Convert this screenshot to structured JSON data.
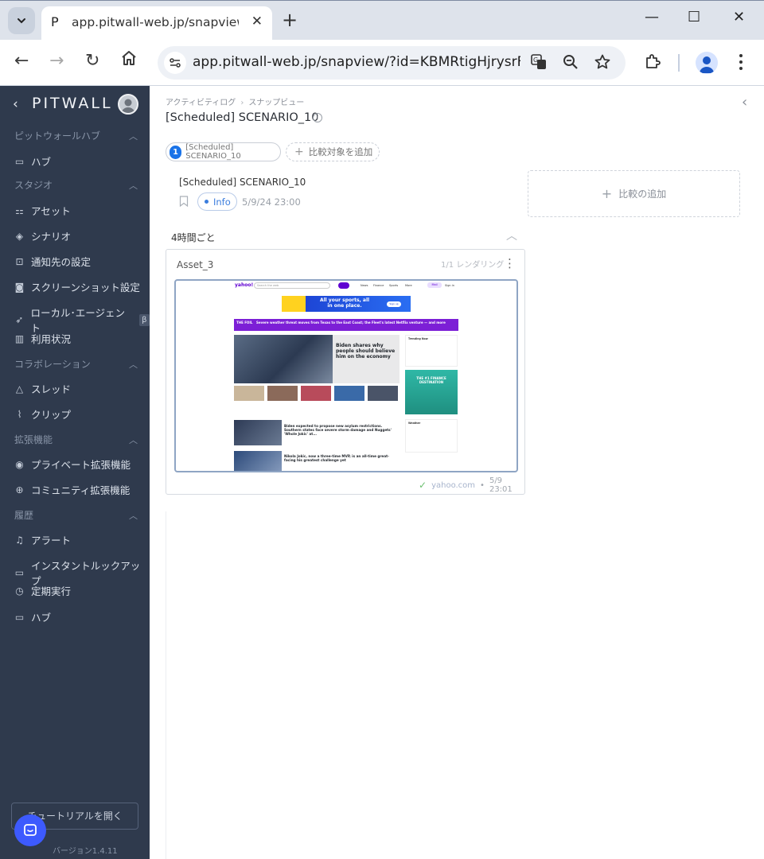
{
  "browser": {
    "tab_title": "app.pitwall-web.jp/snapview/?id",
    "favicon_glyph": "P",
    "url": "app.pitwall-web.jp/snapview/?id=KBMRtigHjrysrFKf..."
  },
  "sidebar": {
    "logo": "PITWALL",
    "sections": [
      {
        "title": "ピットウォールハブ",
        "items": [
          {
            "label": "ハブ",
            "icon": "box-icon"
          }
        ]
      },
      {
        "title": "スタジオ",
        "items": [
          {
            "label": "アセット",
            "icon": "grid-icon"
          },
          {
            "label": "シナリオ",
            "icon": "layers-icon"
          },
          {
            "label": "通知先の設定",
            "icon": "inbox-icon"
          },
          {
            "label": "スクリーンショット設定",
            "icon": "camera-icon"
          },
          {
            "label": "ローカル･エージェント",
            "icon": "rocket-icon",
            "badge": "β"
          },
          {
            "label": "利用状況",
            "icon": "bar-chart-icon"
          }
        ]
      },
      {
        "title": "コラボレーション",
        "items": [
          {
            "label": "スレッド",
            "icon": "triangle-icon"
          },
          {
            "label": "クリップ",
            "icon": "paperclip-icon"
          }
        ]
      },
      {
        "title": "拡張機能",
        "items": [
          {
            "label": "プライベート拡張機能",
            "icon": "user-circle-icon"
          },
          {
            "label": "コミュニティ拡張機能",
            "icon": "globe-icon"
          }
        ]
      },
      {
        "title": "履歴",
        "items": [
          {
            "label": "アラート",
            "icon": "bell-icon"
          },
          {
            "label": "インスタントルックアップ",
            "icon": "monitor-icon"
          },
          {
            "label": "定期実行",
            "icon": "clock-icon"
          },
          {
            "label": "ハブ",
            "icon": "box-icon"
          }
        ]
      }
    ],
    "tutorial_button": "チュートリアルを開く",
    "version": "バージョン1.4.11"
  },
  "main": {
    "breadcrumb": [
      "アクティビティログ",
      "スナップビュー"
    ],
    "title": "[Scheduled] SCENARIO_10",
    "compare_chip": {
      "number": "1",
      "label": "[Scheduled] SCENARIO_10"
    },
    "add_compare_chip": "比較対象を追加",
    "scenario": {
      "title": "[Scheduled] SCENARIO_10",
      "badge": "Info",
      "timestamp": "5/9/24 23:00"
    },
    "add_compare_box": "比較の追加",
    "group_title": "4時間ごと",
    "asset_card": {
      "name": "Asset_3",
      "render_count": "1/1 レンダリング",
      "domain": "yahoo.com",
      "time": "5/9 23:01"
    }
  },
  "thumbnail": {
    "logo": "yahoo!",
    "search_placeholder": "Search the web",
    "nav": [
      "News",
      "Finance",
      "Sports",
      "More"
    ],
    "mail": "Mail",
    "signin": "Sign in",
    "banner": "All your sports, all in one place.",
    "banner_button": "Sign up",
    "alert_label": "THE FOIL",
    "alert": "Severe weather threat moves from Texas to the East Coast; the Fleet's latest Netflix venture — and more",
    "hero_headline": "Biden shares why people should believe him on the economy",
    "story1": "Biden expected to propose new asylum restrictions. Southern states face severe storm damage and Nuggets' 'Whole Jokic' at...",
    "story2": "Nikola Jokic, now a three-time MVP, is an all-time great-facing his greatest challenge yet",
    "rail_trending": "Trending Now",
    "rail_finance": "THE #1 FINANCE DESTINATION",
    "rail_weather": "Weather"
  }
}
